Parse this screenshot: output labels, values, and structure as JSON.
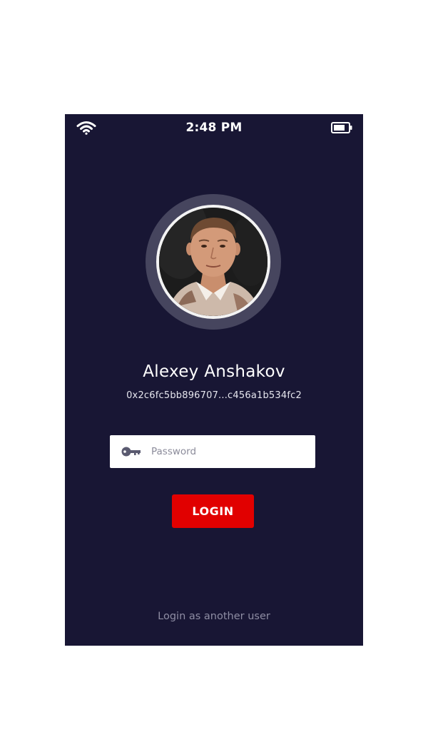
{
  "status_bar": {
    "time": "2:48 PM",
    "wifi_icon": "wifi-icon",
    "battery_icon": "battery-icon"
  },
  "profile": {
    "name": "Alexey Anshakov",
    "wallet_address": "0x2c6fc5bb896707...c456a1b534fc2",
    "avatar_icon": "user-photo"
  },
  "login_form": {
    "password_placeholder": "Password",
    "password_value": "",
    "key_icon": "key-icon",
    "login_label": "LOGIN",
    "alternate_link": "Login as another user"
  },
  "colors": {
    "background": "#181634",
    "avatar_ring": "#46455e",
    "accent": "#e10000",
    "muted_text": "#8e8da3"
  }
}
